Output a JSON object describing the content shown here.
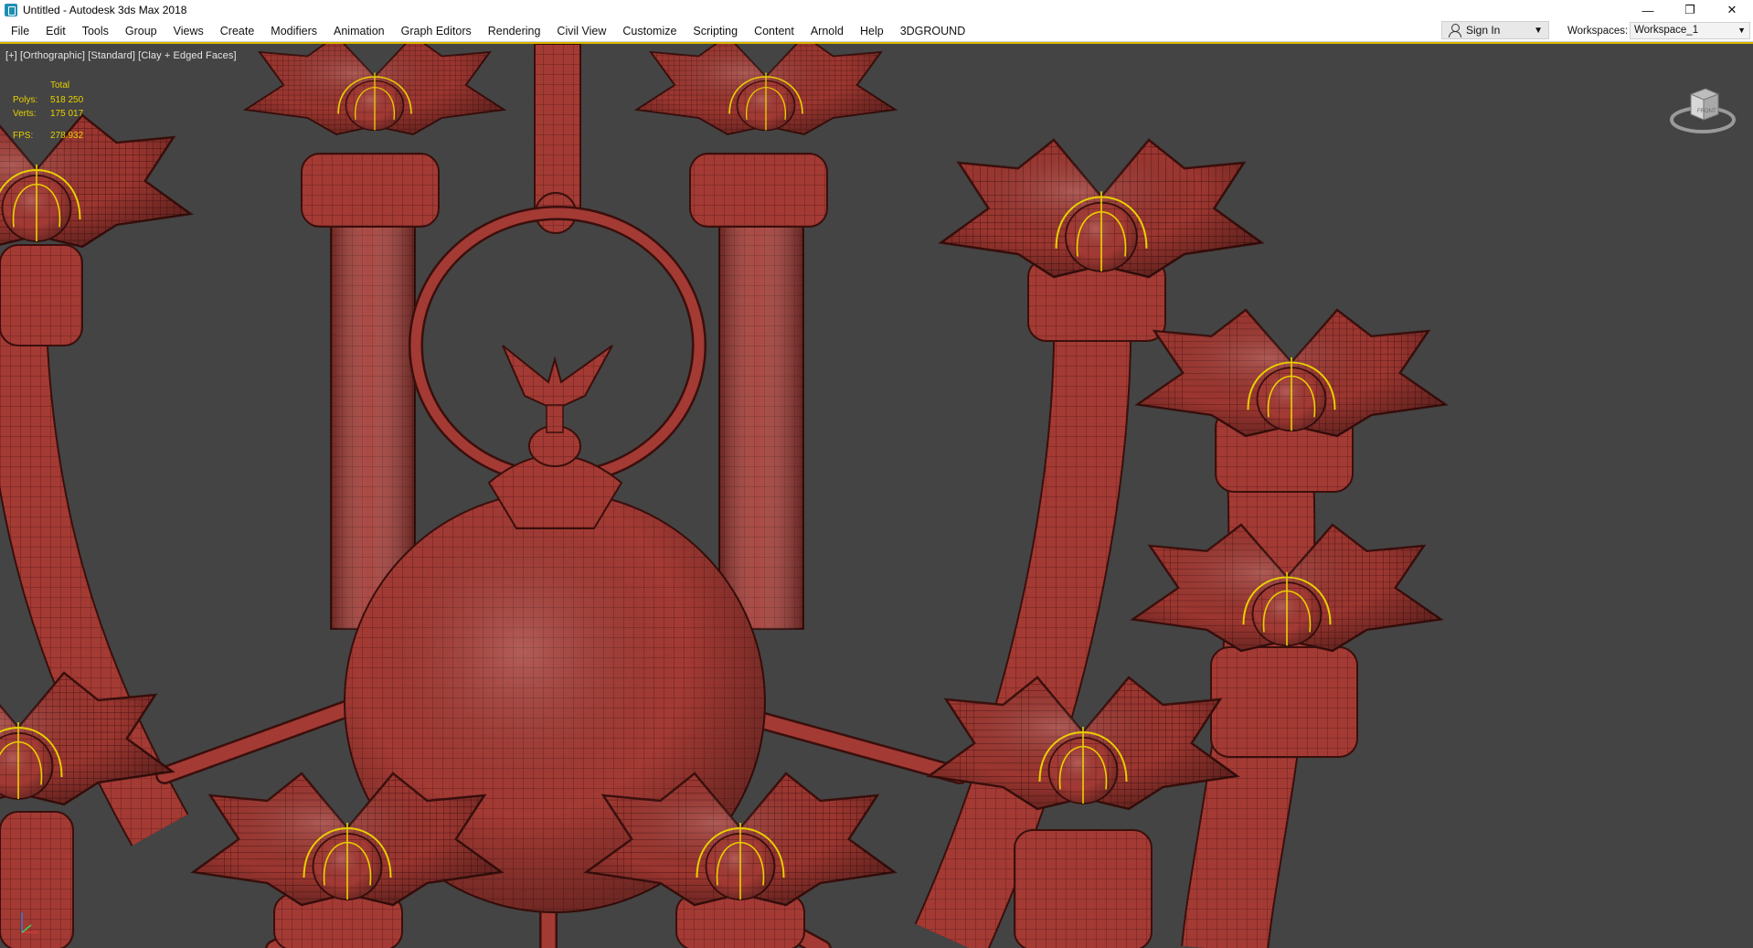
{
  "window": {
    "title": "Untitled - Autodesk 3ds Max 2018",
    "minimize_glyph": "—",
    "restore_glyph": "❐",
    "close_glyph": "✕"
  },
  "menubar": {
    "items": [
      "File",
      "Edit",
      "Tools",
      "Group",
      "Views",
      "Create",
      "Modifiers",
      "Animation",
      "Graph Editors",
      "Rendering",
      "Civil View",
      "Customize",
      "Scripting",
      "Content",
      "Arnold",
      "Help",
      "3DGROUND"
    ],
    "sign_in": "Sign In",
    "workspaces_label": "Workspaces:",
    "workspace_value": "Workspace_1"
  },
  "viewport": {
    "label": "[+] [Orthographic] [Standard] [Clay + Edged Faces]",
    "stats": {
      "total_label": "Total",
      "polys_label": "Polys:",
      "polys_value": "518 250",
      "verts_label": "Verts:",
      "verts_value": "175 017",
      "fps_label": "FPS:",
      "fps_value": "278.932"
    },
    "viewcube_face": "FRONT"
  },
  "colors": {
    "viewport_bg": "#444444",
    "clay": "#a33a34",
    "wire": "#4a1512",
    "highlight": "#e8d000",
    "active_border": "#d7b400"
  },
  "icons": {
    "app": "3ds-max-icon",
    "sign_in": "user-icon",
    "viewcube": "viewcube-icon",
    "axis": "axis-tripod-icon"
  }
}
